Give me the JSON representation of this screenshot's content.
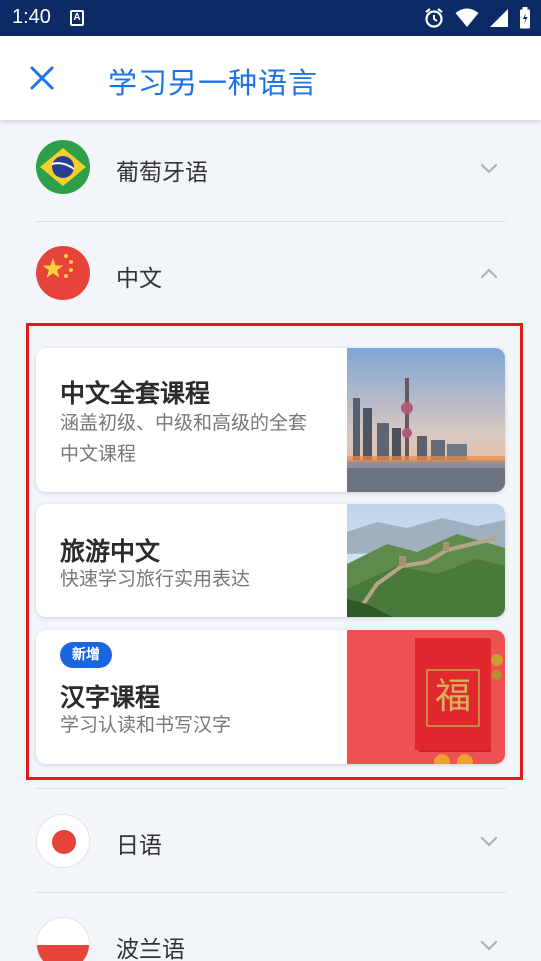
{
  "status_bar": {
    "time": "1:40",
    "notification_icon": "A"
  },
  "app_bar": {
    "title": "学习另一种语言"
  },
  "languages": [
    {
      "label": "葡萄牙语",
      "flag": "brazil",
      "expanded": false
    },
    {
      "label": "中文",
      "flag": "china",
      "expanded": true
    },
    {
      "label": "日语",
      "flag": "japan",
      "expanded": false
    },
    {
      "label": "波兰语",
      "flag": "poland",
      "expanded": false
    }
  ],
  "courses": [
    {
      "title": "中文全套课程",
      "description": "涵盖初级、中级和高级的全套中文课程",
      "image": "city-skyline"
    },
    {
      "title": "旅游中文",
      "description": "快速学习旅行实用表达",
      "image": "great-wall"
    },
    {
      "badge": "新增",
      "title": "汉字课程",
      "description": "学习认读和书写汉字",
      "image": "fu-red-envelope",
      "image_text": "福"
    }
  ],
  "colors": {
    "accent": "#1a73e8",
    "status_bar": "#0b2a66",
    "highlight": "#e31b1b",
    "badge": "#1a66e0"
  }
}
